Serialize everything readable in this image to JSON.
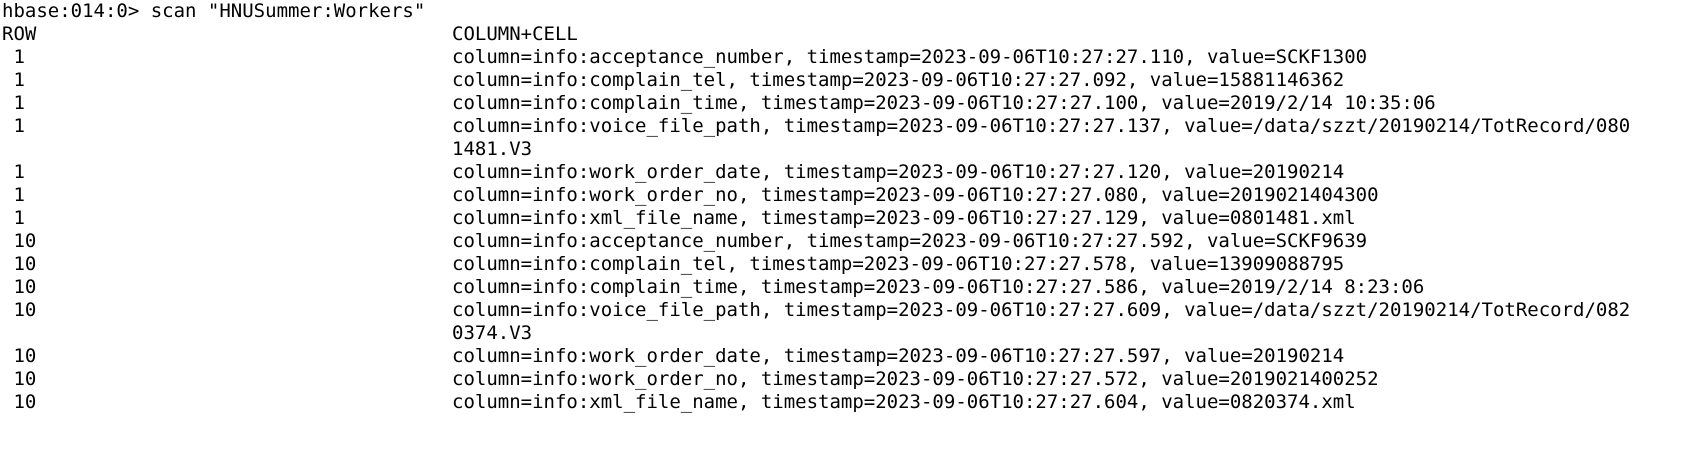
{
  "terminal": {
    "prompt": "hbase:014:0>",
    "command": "scan \"HNUSummer:Workers\"",
    "header": {
      "row": "ROW",
      "column_cell": "COLUMN+CELL"
    },
    "lines": [
      {
        "row": " 1",
        "cell": "column=info:acceptance_number, timestamp=2023-09-06T10:27:27.110, value=SCKF1300"
      },
      {
        "row": " 1",
        "cell": "column=info:complain_tel, timestamp=2023-09-06T10:27:27.092, value=15881146362"
      },
      {
        "row": " 1",
        "cell": "column=info:complain_time, timestamp=2023-09-06T10:27:27.100, value=2019/2/14 10:35:06"
      },
      {
        "row": " 1",
        "cell": "column=info:voice_file_path, timestamp=2023-09-06T10:27:27.137, value=/data/szzt/20190214/TotRecord/080"
      },
      {
        "row": "",
        "cell": "1481.V3"
      },
      {
        "row": " 1",
        "cell": "column=info:work_order_date, timestamp=2023-09-06T10:27:27.120, value=20190214"
      },
      {
        "row": " 1",
        "cell": "column=info:work_order_no, timestamp=2023-09-06T10:27:27.080, value=2019021404300"
      },
      {
        "row": " 1",
        "cell": "column=info:xml_file_name, timestamp=2023-09-06T10:27:27.129, value=0801481.xml"
      },
      {
        "row": " 10",
        "cell": "column=info:acceptance_number, timestamp=2023-09-06T10:27:27.592, value=SCKF9639"
      },
      {
        "row": " 10",
        "cell": "column=info:complain_tel, timestamp=2023-09-06T10:27:27.578, value=13909088795"
      },
      {
        "row": " 10",
        "cell": "column=info:complain_time, timestamp=2023-09-06T10:27:27.586, value=2019/2/14 8:23:06"
      },
      {
        "row": " 10",
        "cell": "column=info:voice_file_path, timestamp=2023-09-06T10:27:27.609, value=/data/szzt/20190214/TotRecord/082"
      },
      {
        "row": "",
        "cell": "0374.V3"
      },
      {
        "row": " 10",
        "cell": "column=info:work_order_date, timestamp=2023-09-06T10:27:27.597, value=20190214"
      },
      {
        "row": " 10",
        "cell": "column=info:work_order_no, timestamp=2023-09-06T10:27:27.572, value=2019021400252"
      },
      {
        "row": " 10",
        "cell": "column=info:xml_file_name, timestamp=2023-09-06T10:27:27.604, value=0820374.xml"
      }
    ]
  }
}
